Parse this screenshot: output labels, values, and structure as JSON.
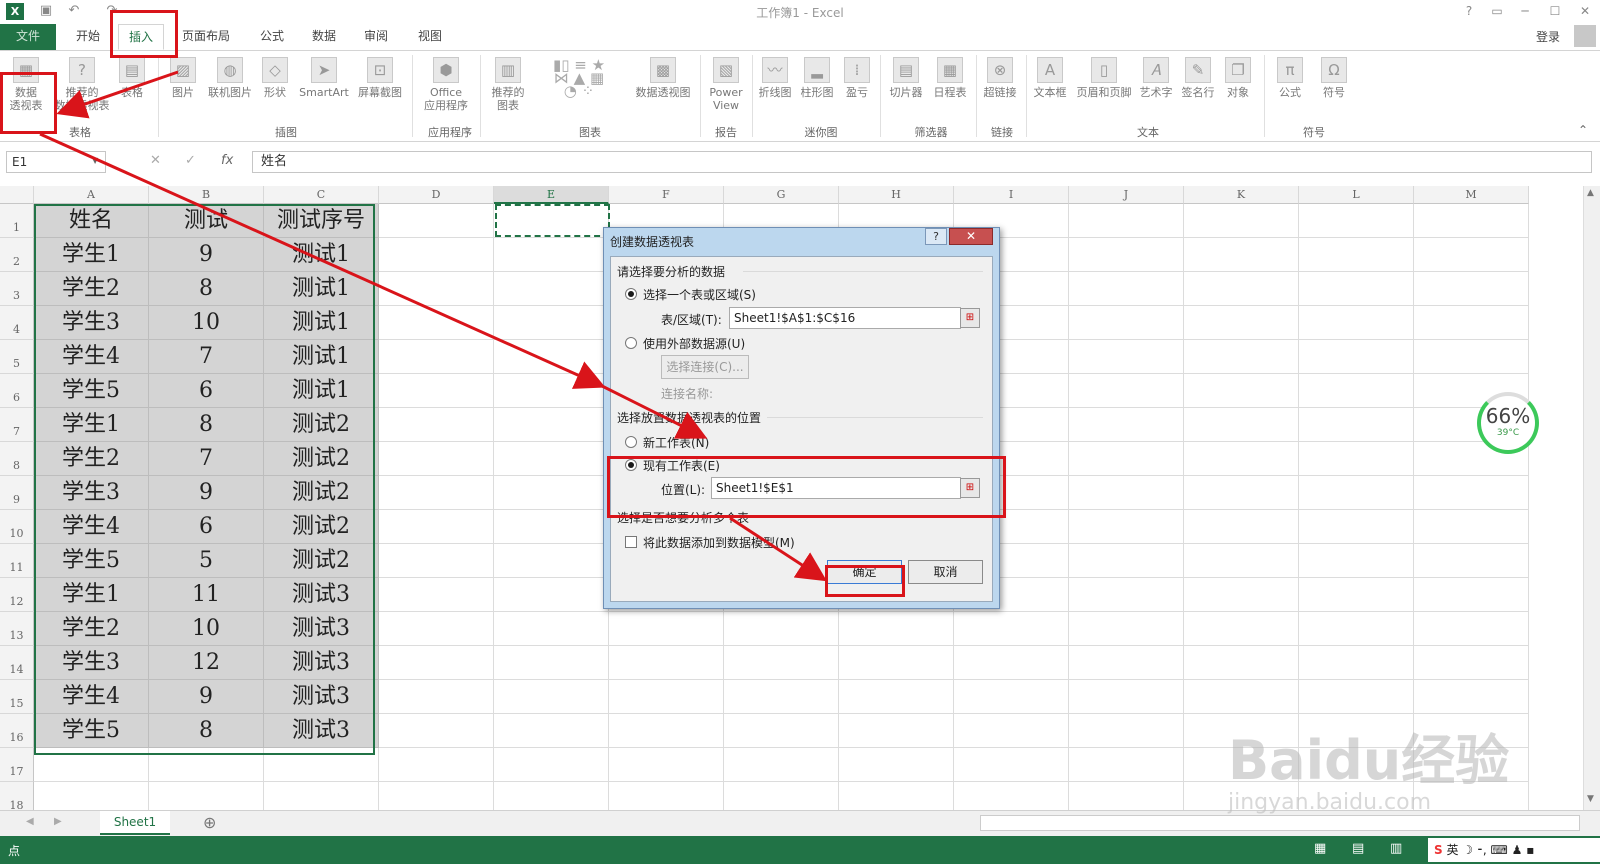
{
  "window": {
    "title": "工作簿1 - Excel",
    "app_icon": "X",
    "help": "?",
    "restore": "▭",
    "minimize": "─",
    "maximize": "☐",
    "close": "✕"
  },
  "tabs": [
    {
      "label": "文件"
    },
    {
      "label": "开始"
    },
    {
      "label": "插入"
    },
    {
      "label": "页面布局"
    },
    {
      "label": "公式"
    },
    {
      "label": "数据"
    },
    {
      "label": "审阅"
    },
    {
      "label": "视图"
    }
  ],
  "account": {
    "login": "登录"
  },
  "ribbon": {
    "buttons": [
      {
        "label": "数据\n透视表",
        "icon": "pivot-table-icon"
      },
      {
        "label": "推荐的\n数据透视表",
        "icon": "recommended-pivot-icon"
      },
      {
        "label": "表格",
        "icon": "table-icon"
      },
      {
        "label": "图片",
        "icon": "picture-icon"
      },
      {
        "label": "联机图片",
        "icon": "online-picture-icon"
      },
      {
        "label": "形状",
        "icon": "shapes-icon"
      },
      {
        "label": "SmartArt",
        "icon": "smartart-icon"
      },
      {
        "label": "屏幕截图",
        "icon": "screenshot-icon"
      },
      {
        "label": "Office\n应用程序",
        "icon": "office-apps-icon"
      },
      {
        "label": "推荐的\n图表",
        "icon": "recommended-chart-icon"
      },
      {
        "label": "数据透视图",
        "icon": "pivot-chart-icon"
      },
      {
        "label": "Power\nView",
        "icon": "power-view-icon"
      },
      {
        "label": "折线图",
        "icon": "sparkline-line-icon"
      },
      {
        "label": "柱形图",
        "icon": "sparkline-column-icon"
      },
      {
        "label": "盈亏",
        "icon": "sparkline-winloss-icon"
      },
      {
        "label": "切片器",
        "icon": "slicer-icon"
      },
      {
        "label": "日程表",
        "icon": "timeline-icon"
      },
      {
        "label": "超链接",
        "icon": "hyperlink-icon"
      },
      {
        "label": "文本框",
        "icon": "textbox-icon"
      },
      {
        "label": "页眉和页脚",
        "icon": "header-footer-icon"
      },
      {
        "label": "艺术字",
        "icon": "wordart-icon"
      },
      {
        "label": "签名行",
        "icon": "signature-icon"
      },
      {
        "label": "对象",
        "icon": "object-icon"
      },
      {
        "label": "公式",
        "icon": "equation-icon"
      },
      {
        "label": "符号",
        "icon": "symbol-icon"
      }
    ],
    "groups": [
      {
        "label": "表格"
      },
      {
        "label": "插图"
      },
      {
        "label": "应用程序"
      },
      {
        "label": "图表"
      },
      {
        "label": "报告"
      },
      {
        "label": "迷你图"
      },
      {
        "label": "筛选器"
      },
      {
        "label": "链接"
      },
      {
        "label": "文本"
      },
      {
        "label": "符号"
      }
    ]
  },
  "formula_bar": {
    "name_box": "E1",
    "content": "姓名",
    "fx": "fx",
    "cancel": "✕",
    "enter": "✓"
  },
  "columns": [
    "A",
    "B",
    "C",
    "D",
    "E",
    "F",
    "G",
    "H",
    "I",
    "J",
    "K",
    "L",
    "M"
  ],
  "rows": [
    "1",
    "2",
    "3",
    "4",
    "5",
    "6",
    "7",
    "8",
    "9",
    "10",
    "11",
    "12",
    "13",
    "14",
    "15",
    "16",
    "17",
    "18"
  ],
  "table": {
    "headers": [
      "姓名",
      "测试",
      "测试序号"
    ],
    "rows": [
      [
        "学生1",
        "9",
        "测试1"
      ],
      [
        "学生2",
        "8",
        "测试1"
      ],
      [
        "学生3",
        "10",
        "测试1"
      ],
      [
        "学生4",
        "7",
        "测试1"
      ],
      [
        "学生5",
        "6",
        "测试1"
      ],
      [
        "学生1",
        "8",
        "测试2"
      ],
      [
        "学生2",
        "7",
        "测试2"
      ],
      [
        "学生3",
        "9",
        "测试2"
      ],
      [
        "学生4",
        "6",
        "测试2"
      ],
      [
        "学生5",
        "5",
        "测试2"
      ],
      [
        "学生1",
        "11",
        "测试3"
      ],
      [
        "学生2",
        "10",
        "测试3"
      ],
      [
        "学生3",
        "12",
        "测试3"
      ],
      [
        "学生4",
        "9",
        "测试3"
      ],
      [
        "学生5",
        "8",
        "测试3"
      ]
    ]
  },
  "dialog": {
    "title": "创建数据透视表",
    "section1": "请选择要分析的数据",
    "opt_table": "选择一个表或区域(S)",
    "table_range_label": "表/区域(T):",
    "table_range_value": "Sheet1!$A$1:$C$16",
    "opt_external": "使用外部数据源(U)",
    "choose_conn": "选择连接(C)...",
    "conn_name": "连接名称:",
    "section2": "选择放置数据透视表的位置",
    "opt_new": "新工作表(N)",
    "opt_existing": "现有工作表(E)",
    "location_label": "位置(L):",
    "location_value": "Sheet1!$E$1",
    "section3": "选择是否想要分析多个表",
    "add_model": "将此数据添加到数据模型(M)",
    "ok": "确定",
    "cancel": "取消"
  },
  "sheet_tabs": {
    "active": "Sheet1",
    "add": "⊕"
  },
  "status": {
    "text": "点"
  },
  "widget": {
    "percent": "66%",
    "temp": "39°C"
  },
  "watermark": {
    "text": "Baidu经验",
    "url": "jingyan.baidu.com"
  },
  "colors": {
    "excel_green": "#217346",
    "highlight_red": "#d9141a"
  }
}
